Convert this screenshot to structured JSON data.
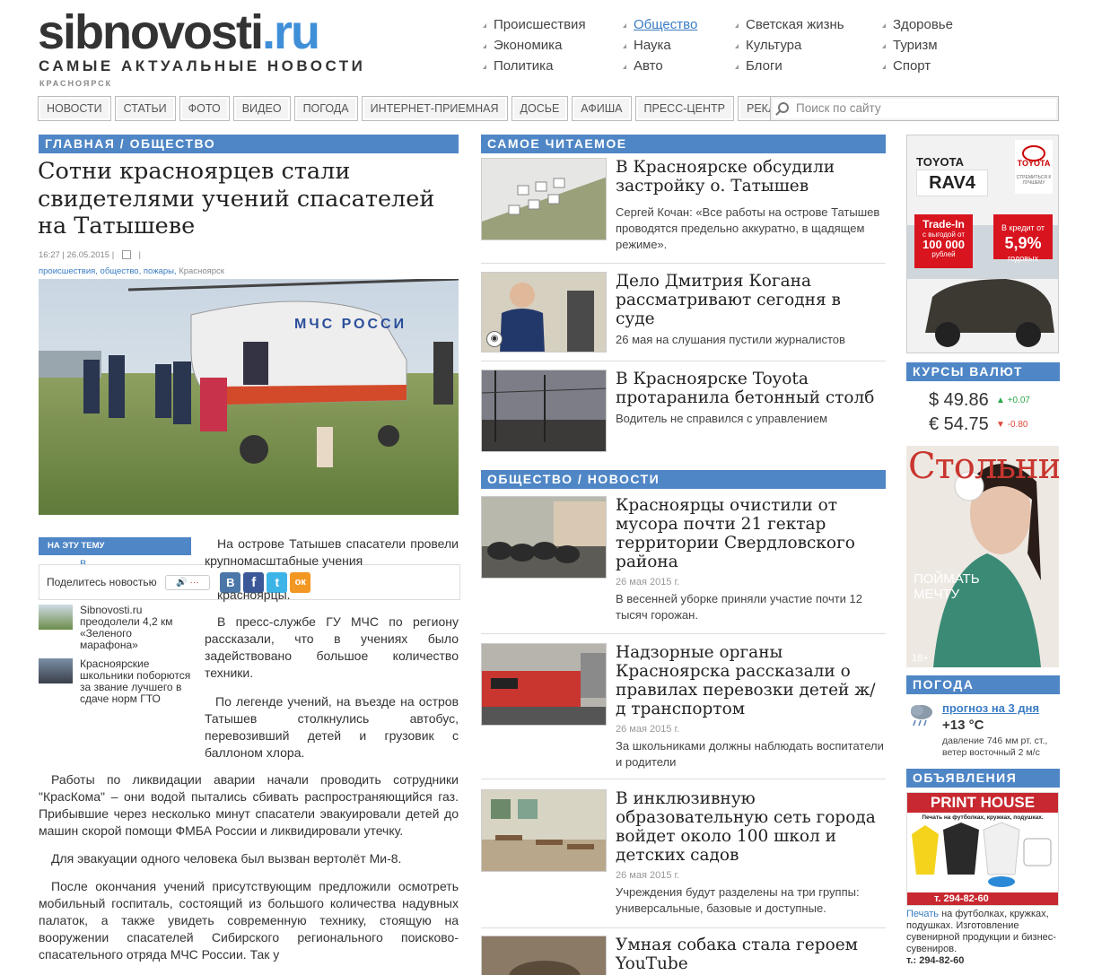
{
  "site": {
    "logo_main": "sibnovosti",
    "logo_tld": ".ru",
    "slogan": "САМЫЕ АКТУАЛЬНЫЕ НОВОСТИ",
    "city": "КРАСНОЯРСК"
  },
  "topnav": [
    [
      "Происшествия",
      "Экономика",
      "Политика"
    ],
    [
      "Общество",
      "Наука",
      "Авто"
    ],
    [
      "Светская жизнь",
      "Культура",
      "Блоги"
    ],
    [
      "Здоровье",
      "Туризм",
      "Спорт"
    ]
  ],
  "menu": [
    "НОВОСТИ",
    "СТАТЬИ",
    "ФОТО",
    "ВИДЕО",
    "ПОГОДА",
    "ИНТЕРНЕТ-ПРИЕМНАЯ",
    "ДОСЬЕ",
    "АФИША",
    "ПРЕСС-ЦЕНТР",
    "РЕКЛАМА"
  ],
  "search": {
    "placeholder": "Поиск по сайту"
  },
  "article": {
    "breadcrumb": "ГЛАВНАЯ / ОБЩЕСТВО",
    "title": "Сотни красноярцев стали свидетелями учений спасателей на Татышеве",
    "time": "16:27",
    "date": "26.05.2015",
    "tags": "происшествия, общество, пожары,",
    "tag_city": "Красноярск",
    "heli_text": "МЧС РОССИ",
    "on_topic": "НА ЭТУ ТЕМУ",
    "on_topic_cut": "В",
    "share_label": "Поделитесь новостью",
    "social": [
      "В",
      "f",
      "t",
      "ок"
    ],
    "related": [
      "Sibnovosti.ru преодолели 4,2 км «Зеленого марафона»",
      "Красноярские школьники поборются за звание лучшего в сдаче норм ГТО"
    ],
    "p1": "На острове Татышев спасатели провели крупномасштабные учения",
    "p1_tail": "красноярцы.",
    "p2": "В пресс-службе ГУ МЧС по региону рассказали, что в учениях было задействовано большое количество техники.",
    "p3": "По легенде учений, на въезде на остров Татышев столкнулись автобус, перевозивший детей и грузовик с баллоном хлора.",
    "p4": "Работы по ликвидации аварии начали проводить сотрудники \"КрасКома\" – они водой пытались сбивать распространяющийся газ. Прибывшие через несколько минут спасатели эвакуировали детей до машин скорой помощи ФМБА России и ликвидировали утечку.",
    "p5": "Для эвакуации одного человека был вызван вертолёт Ми-8.",
    "p6": "После окончания учений присутствующим предложили осмотреть мобильный госпиталь, состоящий из большого количества надувных палаток, а также увидеть современную технику, стоящую на вооружении спасателей Сибирского регионального поисково-спасательного отряда МЧС России. Так у"
  },
  "most_read": {
    "header": "САМОЕ ЧИТАЕМОЕ",
    "items": [
      {
        "title": "В Красноярске обсудили застройку о. Татышев",
        "text": "Сергей Кочан: «Все работы на острове Татышев проводятся предельно аккуратно, в щадящем режиме»."
      },
      {
        "title": "Дело Дмитрия Когана рассматривают сегодня в суде",
        "text": "26 мая на слушания пустили журналистов"
      },
      {
        "title": "В Красноярске Toyota протаранила бетонный столб",
        "text": "Водитель не справился с управлением"
      }
    ]
  },
  "society_news": {
    "header": "ОБЩЕСТВО / НОВОСТИ",
    "items": [
      {
        "title": "Красноярцы очистили от мусора почти 21 гектар территории Свердловского района",
        "date": "26 мая 2015 г.",
        "text": "В весенней уборке приняли участие почти 12 тысяч горожан."
      },
      {
        "title": "Надзорные органы Красноярска рассказали о правилах перевозки детей ж/д транспортом",
        "date": "26 мая 2015 г.",
        "text": "За школьниками должны наблюдать воспитатели и родители"
      },
      {
        "title": "В инклюзивную образовательную сеть города войдет около 100 школ и детских садов",
        "date": "26 мая 2015 г.",
        "text": "Учреждения будут разделены на три группы: универсальные, базовые и доступные."
      },
      {
        "title": "Умная собака стала героем YouTube",
        "date": "",
        "text": ""
      }
    ]
  },
  "toyota_ad": {
    "brand": "TOYOTA",
    "model": "RAV4",
    "logo_text": "TOYOTA",
    "slogan": "СТРЕМИТЬСЯ К ЛУЧШЕМУ",
    "tradein_1": "Trade-In",
    "tradein_2": "с выгодой от",
    "tradein_3": "100 000",
    "tradein_4": "рублей",
    "credit_1": "В кредит от",
    "credit_2": "5,9%",
    "credit_3": "годовых"
  },
  "currency": {
    "header": "КУРСЫ ВАЛЮТ",
    "usd": "$ 49.86",
    "usd_change": "+0.07",
    "eur": "€ 54.75",
    "eur_change": "-0.80",
    "up_color": "#2aa84a",
    "down_color": "#e0483a"
  },
  "magazine": {
    "title": "Стольник",
    "cover_line": "ПОЙМАТЬ МЕЧТУ",
    "age": "18+"
  },
  "weather": {
    "header": "ПОГОДА",
    "forecast_link": "прогноз на 3 дня",
    "temp": "+13 °C",
    "details": "давление 746 мм рт. ст., ветер восточный 2 м/с"
  },
  "ads": {
    "header": "ОБЪЯВЛЕНИЯ",
    "brand": "PRINT HOUSE",
    "sub": "Печать на футболках, кружках, подушках.",
    "phone_banner": "т. 294-82-60",
    "link": "Печать",
    "text": "на футболках, кружках, подушках. Изготовление сувенирной продукции и бизнес-сувениров.",
    "phone": "т.: 294-82-60"
  }
}
